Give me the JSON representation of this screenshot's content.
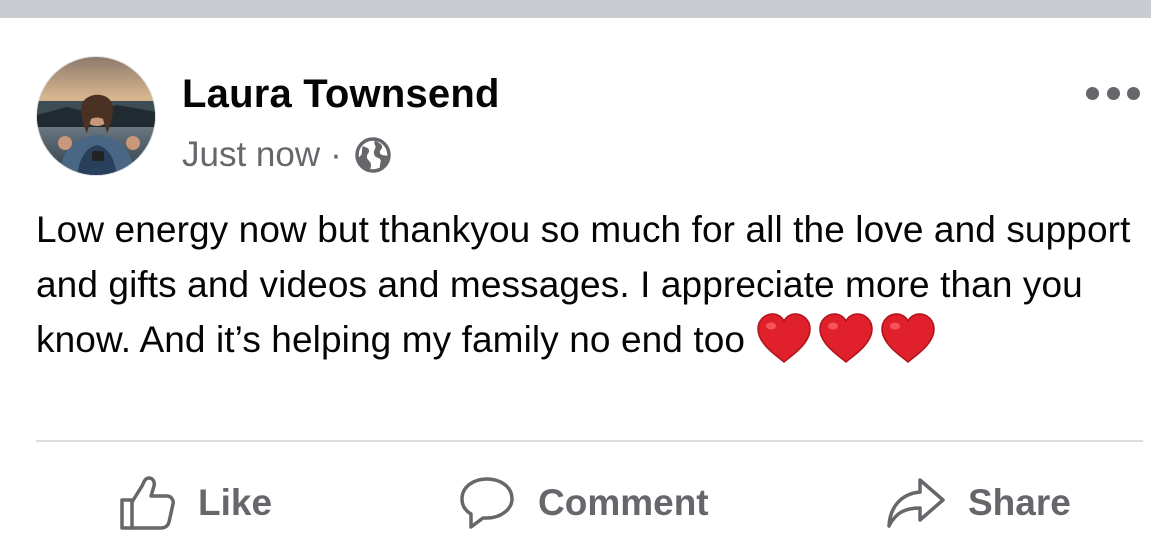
{
  "post": {
    "author": "Laura Townsend",
    "timestamp": "Just now",
    "separator": "·",
    "audience_icon": "globe-icon",
    "more_icon": "more-options-icon",
    "text": "Low energy now but thankyou so much for all the love and support and gifts and videos and messages. I appreciate more than you know. And it’s helping my family no end too",
    "emoji": [
      "red-heart",
      "red-heart",
      "red-heart"
    ]
  },
  "actions": {
    "like_label": "Like",
    "comment_label": "Comment",
    "share_label": "Share"
  },
  "colors": {
    "primary_text": "#050505",
    "secondary_text": "#65676b",
    "divider": "#dadde1",
    "heart": "#e0202a"
  }
}
